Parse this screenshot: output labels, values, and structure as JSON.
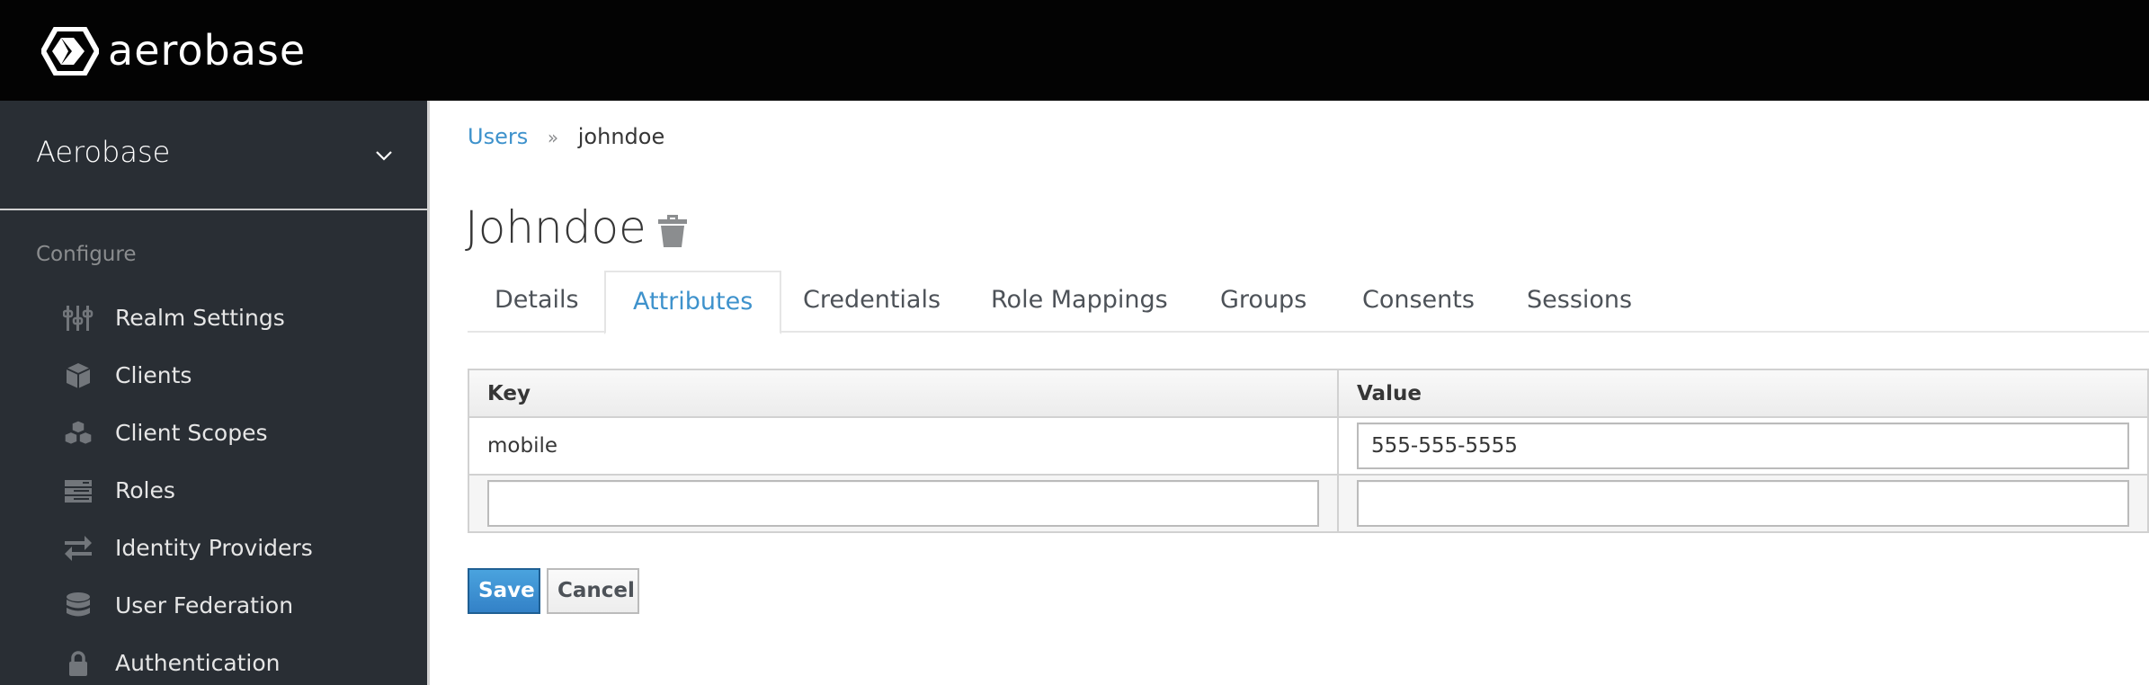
{
  "header": {
    "brand": "aerobase",
    "logo_icon": "aerobase-hexagon-logo"
  },
  "sidebar": {
    "realm_name": "Aerobase",
    "realm_chevron_icon": "chevron-down-icon",
    "section_label": "Configure",
    "items": [
      {
        "label": "Realm Settings",
        "icon": "sliders-icon"
      },
      {
        "label": "Clients",
        "icon": "cube-icon"
      },
      {
        "label": "Client Scopes",
        "icon": "cubes-icon"
      },
      {
        "label": "Roles",
        "icon": "server-stack-icon"
      },
      {
        "label": "Identity Providers",
        "icon": "exchange-arrows-icon"
      },
      {
        "label": "User Federation",
        "icon": "database-icon"
      },
      {
        "label": "Authentication",
        "icon": "lock-icon"
      }
    ]
  },
  "breadcrumb": {
    "parent": "Users",
    "separator": "»",
    "current": "johndoe"
  },
  "page": {
    "title": "Johndoe",
    "delete_icon": "trash-icon"
  },
  "tabs": [
    {
      "label": "Details",
      "active": false
    },
    {
      "label": "Attributes",
      "active": true
    },
    {
      "label": "Credentials",
      "active": false
    },
    {
      "label": "Role Mappings",
      "active": false
    },
    {
      "label": "Groups",
      "active": false
    },
    {
      "label": "Consents",
      "active": false
    },
    {
      "label": "Sessions",
      "active": false
    }
  ],
  "attributes_table": {
    "columns": [
      "Key",
      "Value"
    ],
    "rows": [
      {
        "key": "mobile",
        "value": "555-555-5555"
      }
    ],
    "new_row": {
      "key": "",
      "value": ""
    }
  },
  "actions": {
    "save_label": "Save",
    "cancel_label": "Cancel"
  },
  "colors": {
    "topbar": "#030303",
    "sidebar": "#292e34",
    "accent": "#3e92cc",
    "save_button": "#3a8fd3"
  }
}
